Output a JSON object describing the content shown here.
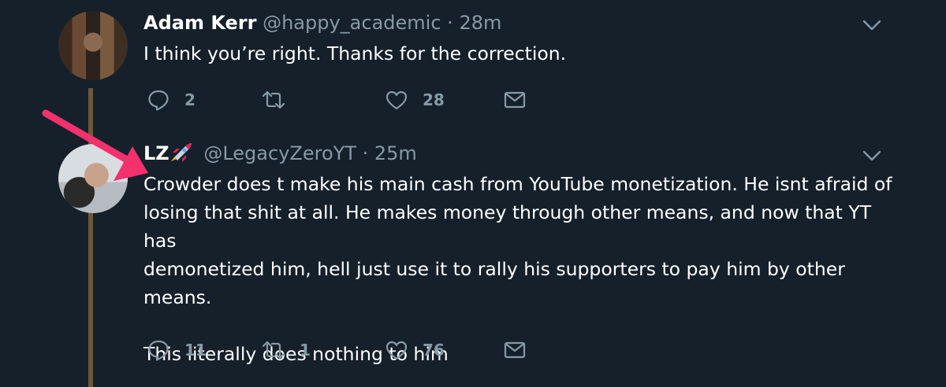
{
  "tweets": [
    {
      "name": "Adam Kerr",
      "handle": "@happy_academic",
      "separator": "·",
      "time": "28m",
      "text": "I think you’re right. Thanks for the correction.",
      "replies": "2",
      "retweets": "",
      "likes": "28"
    },
    {
      "name": "LZ",
      "handle": "@LegacyZeroYT",
      "separator": "·",
      "time": "25m",
      "text": "Crowder does t make his main cash from YouTube monetization. He isnt afraid of\nlosing that shit at all. He makes money through other means, and now that YT has\ndemonetized him, hell just use it to rally his supporters to pay him by other means.\n\nThis literally does nothing to him",
      "replies": "11",
      "retweets": "1",
      "likes": "76"
    }
  ],
  "icons": {
    "reply": "speech-bubble-icon",
    "retweet": "retweet-icon",
    "like": "heart-icon",
    "dm": "envelope-icon",
    "caret": "chevron-down-icon",
    "emoji": "rocket-icon"
  },
  "colors": {
    "background": "#15202b",
    "muted": "#8899a6",
    "text": "#ffffff",
    "thread_line": "#6b5a35",
    "arrow": "#f2316d"
  }
}
